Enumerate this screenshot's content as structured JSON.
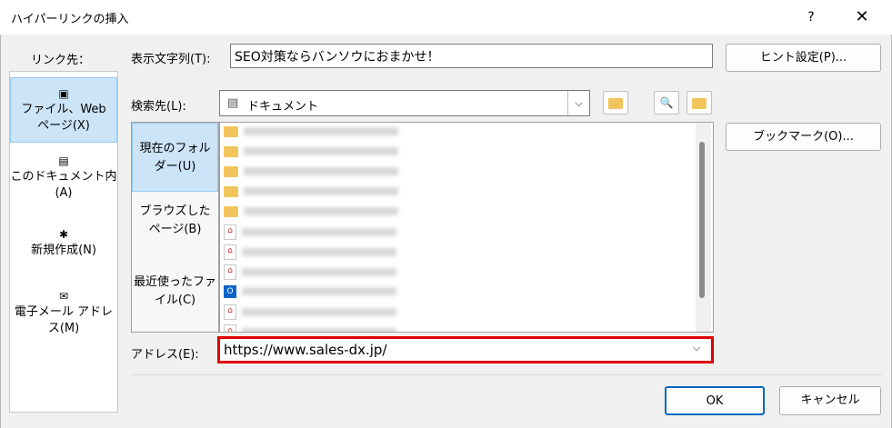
{
  "dialog": {
    "title": "ハイパーリンクの挿入",
    "help_glyph": "?",
    "close_glyph": "✕"
  },
  "link_to": {
    "label": "リンク先：",
    "items": [
      {
        "line1": "ファイル、Web",
        "line2": "ページ(X)",
        "icon": "web-page-icon",
        "selected": true
      },
      {
        "line1": "このドキュメント内",
        "line2": "(A)",
        "icon": "document-place-icon",
        "selected": false
      },
      {
        "line1": "新規作成(N)",
        "line2": "",
        "icon": "new-document-icon",
        "selected": false
      },
      {
        "line1": "電子メール アドレ",
        "line2": "ス(M)",
        "icon": "email-icon",
        "selected": false
      }
    ]
  },
  "text_to_display": {
    "label": "表示文字列(T):",
    "value": "SEO対策ならバンソウにおまかせ！"
  },
  "screentip_button": "ヒント設定(P)...",
  "look_in": {
    "label": "検索先(L):",
    "value": "ドキュメント",
    "icon": "documents-folder-icon"
  },
  "toolbar_icons": [
    "up-folder-icon",
    "browse-web-icon",
    "browse-file-icon"
  ],
  "bookmark_button": "ブックマーク(O)...",
  "location_tabs": [
    {
      "line1": "現在のフォル",
      "line2": "ダー(U)",
      "selected": true
    },
    {
      "line1": "ブラウズした",
      "line2": "ページ(B)",
      "selected": false
    },
    {
      "line1": "最近使ったファ",
      "line2": "イル(C)",
      "selected": false
    }
  ],
  "files": [
    {
      "type": "folder"
    },
    {
      "type": "folder"
    },
    {
      "type": "folder"
    },
    {
      "type": "folder"
    },
    {
      "type": "folder"
    },
    {
      "type": "pdf"
    },
    {
      "type": "pdf"
    },
    {
      "type": "pdf"
    },
    {
      "type": "outlook"
    },
    {
      "type": "pdf"
    },
    {
      "type": "pdf"
    }
  ],
  "address": {
    "label": "アドレス(E):",
    "value": "https://www.sales-dx.jp/",
    "highlight_color": "#e00000"
  },
  "ok_button": "OK",
  "cancel_button": "キャンセル",
  "colors": {
    "selection": "#cce4f7",
    "folder": "#f2c55c"
  }
}
